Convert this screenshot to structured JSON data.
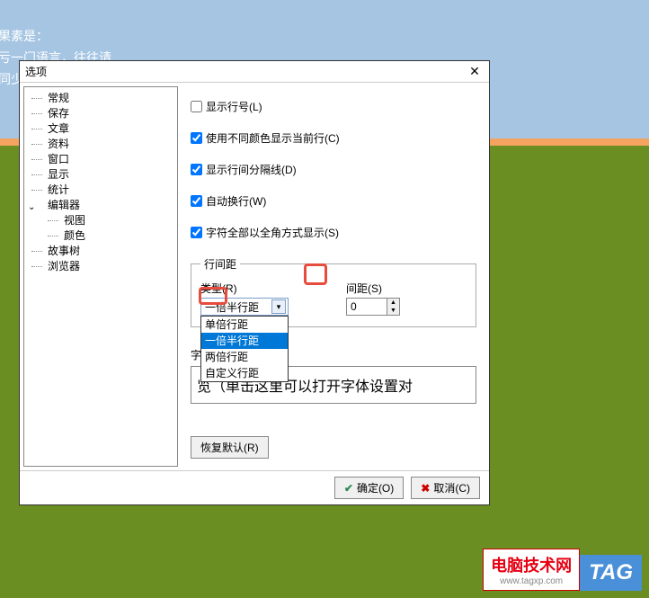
{
  "background": {
    "line1": "果素是：",
    "line2": "亏一门语言，往往请",
    "line3": "同少"
  },
  "dialog": {
    "title": "选项",
    "tree": {
      "items": [
        "常规",
        "保存",
        "文章",
        "资料",
        "窗口",
        "显示",
        "统计"
      ],
      "editor": {
        "label": "编辑器",
        "children": [
          "视图",
          "颜色"
        ]
      },
      "tail": [
        "故事树",
        "浏览器"
      ]
    },
    "checkboxes": {
      "show_line_number": "显示行号(L)",
      "use_diff_color": "使用不同颜色显示当前行(C)",
      "show_separator": "显示行间分隔线(D)",
      "auto_wrap": "自动换行(W)",
      "full_width": "字符全部以全角方式显示(S)"
    },
    "spacing": {
      "legend": "行间距",
      "type_label": "类型(R)",
      "interval_label": "间距(S)",
      "selected": "一倍半行距",
      "options": [
        "单倍行距",
        "一倍半行距",
        "两倍行距",
        "自定义行距"
      ],
      "interval_value": "0"
    },
    "font_label": "字体",
    "preview": "览（单击这里可以打开字体设置对",
    "restore": "恢复默认(R)",
    "ok": "确定(O)",
    "cancel": "取消(C)"
  },
  "watermark": {
    "text": "电脑技术网",
    "url": "www.tagxp.com",
    "tag": "TAG"
  }
}
